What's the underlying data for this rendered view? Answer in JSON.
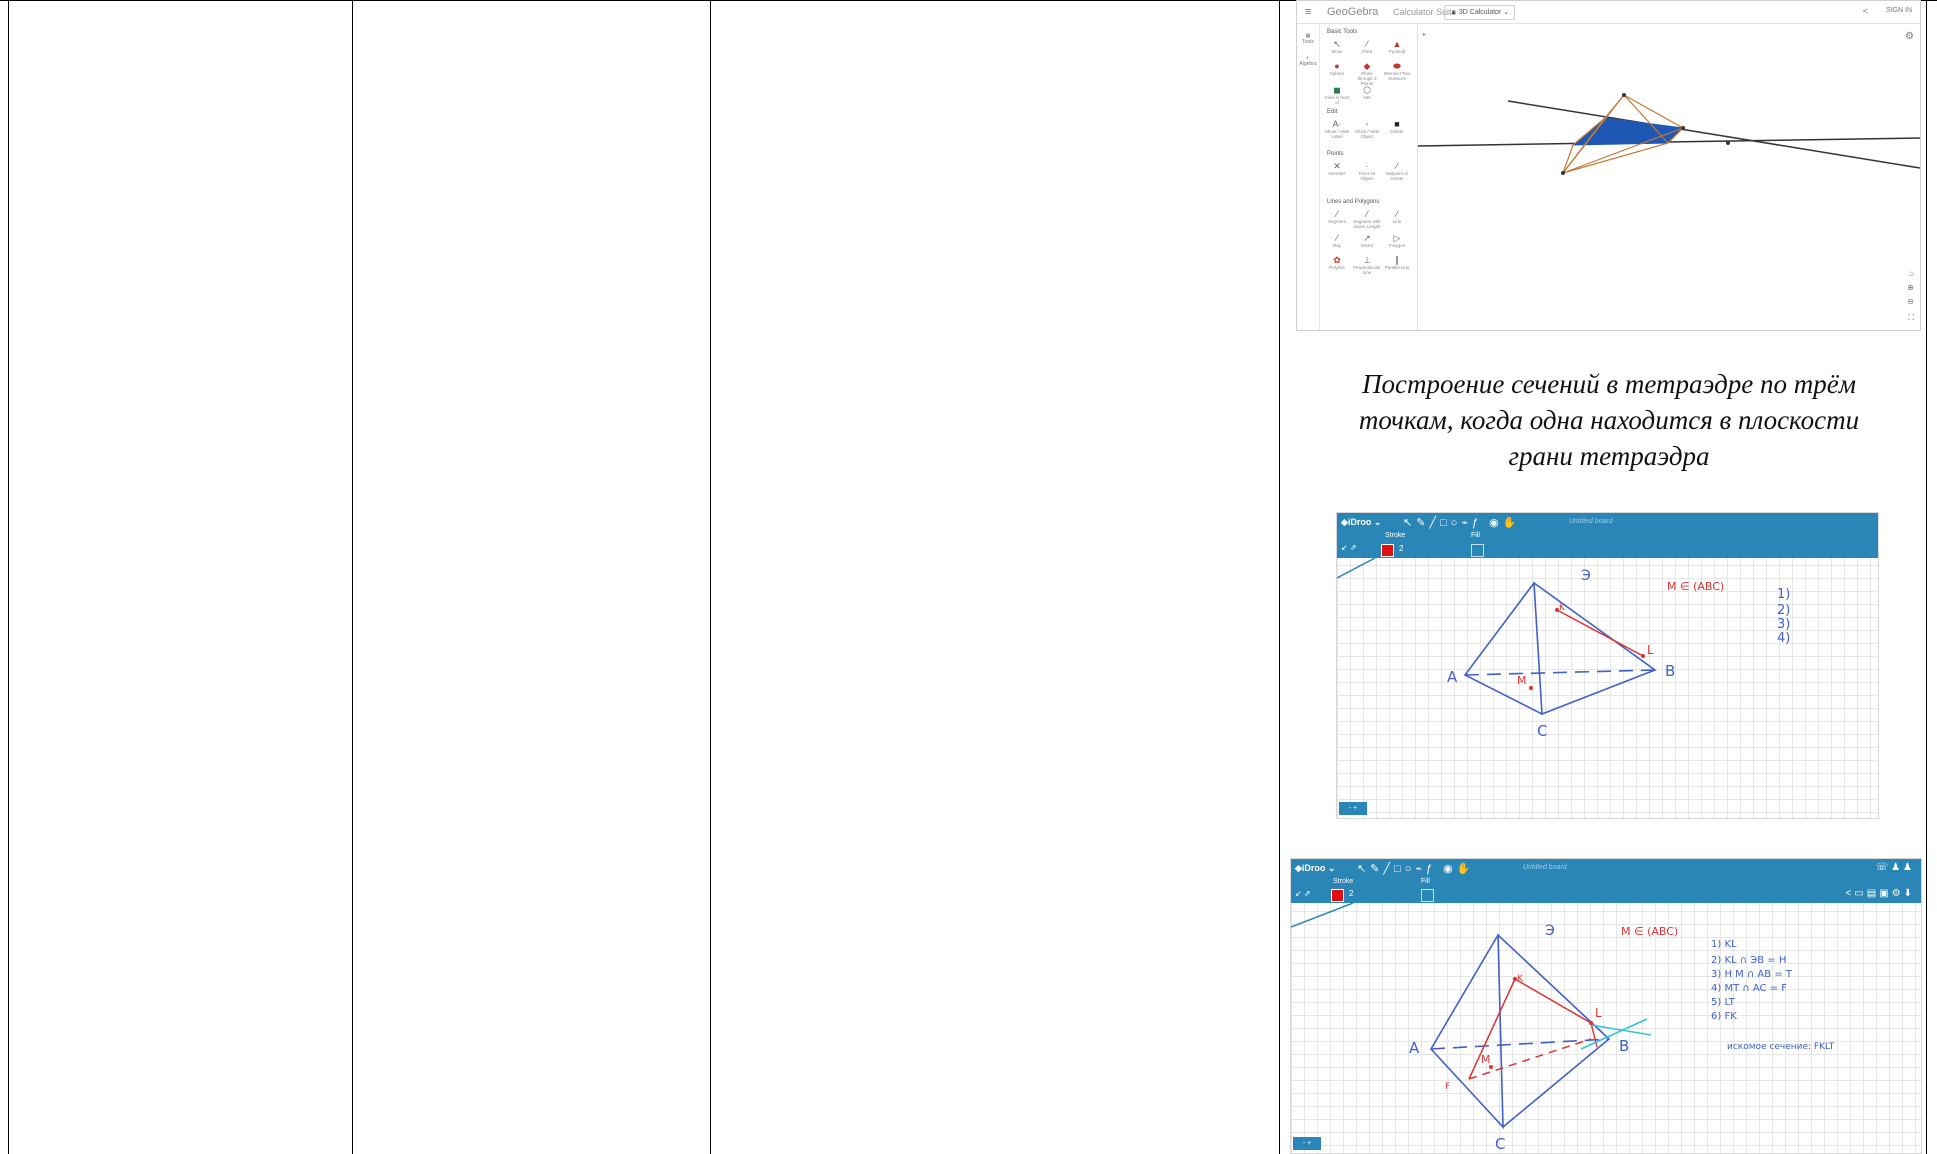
{
  "caption": {
    "line1": "Построение сечений в тетраэдре по трём",
    "line2": "точкам, когда одна находится в плоскости",
    "line3": "грани тетраэдра"
  },
  "geogebra": {
    "brand": "GeoGebra",
    "suite": "Calculator Suite",
    "app": "3D Calculator",
    "sign_in": "SIGN IN",
    "rail": {
      "tools": "Tools",
      "algebra": "Algebra"
    },
    "sections": {
      "basic": "Basic Tools",
      "edit": "Edit",
      "points": "Points",
      "lines": "Lines and Polygons"
    },
    "tools": {
      "move": "Move",
      "point": "Point",
      "pyramid": "Pyramid",
      "sphere": "Sphere",
      "plane_through_points": "Plane through 3 Points",
      "intersect_surfaces": "Intersect Two Surfaces",
      "net": "Net",
      "show_hide_label": "Show / Hide Label",
      "show_hide_object": "Show / Hide Object",
      "delete": "Delete",
      "view_in_front": "View in front of",
      "intersect": "Intersect",
      "point_on_object": "Point on Object",
      "midpoint": "Midpoint or Center",
      "segment": "Segment",
      "segment_length": "Segment with Given Length",
      "line": "Line",
      "ray": "Ray",
      "vector": "Vector",
      "polygon": "Polygon",
      "polyline": "Polyline",
      "perpendicular": "Perpendicular Line",
      "parallel": "Parallel Line"
    }
  },
  "idroo": {
    "logo": "iDroo",
    "board": "Untitled board",
    "stroke_label": "Stroke",
    "stroke_value": "2",
    "fill_label": "Fill",
    "stroke_color": "#dd1111",
    "pager": "- +",
    "board1": {
      "vertex_top": "Э",
      "vertex_a": "A",
      "vertex_b": "B",
      "vertex_c": "C",
      "point_k": "K",
      "point_l": "L",
      "point_m": "M",
      "condition": "M ∈ (ABC)",
      "steps": [
        "1)",
        "2)",
        "3)",
        "4)"
      ]
    },
    "board2": {
      "vertex_top": "Э",
      "vertex_a": "A",
      "vertex_b": "B",
      "vertex_c": "C",
      "point_k": "K",
      "point_l": "L",
      "point_m": "M",
      "point_f": "F",
      "condition": "M ∈ (ABC)",
      "steps": [
        "1) KL",
        "2) KL ∩ ЭB = H",
        "3) H M ∩ AB = T",
        "4) MT ∩ AC = F",
        "5) LT",
        "6) FK"
      ],
      "result": "искомое сечение: FKLT"
    }
  }
}
